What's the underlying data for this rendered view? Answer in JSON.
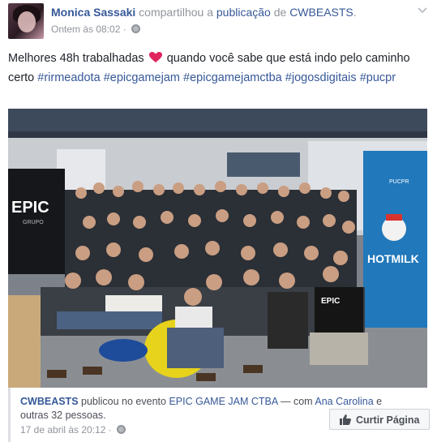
{
  "header": {
    "author": "Monica Sassaki",
    "verb": "compartilhou a",
    "object": "publicação",
    "preposition": "de",
    "source": "CWBEASTS",
    "period": ".",
    "timestamp": "Ontem às 08:02",
    "separator": "·",
    "privacy_icon": "globe-icon",
    "menu_icon": "chevron-down-icon"
  },
  "post": {
    "text_before_heart": "Melhores 48h trabalhadas",
    "heart_icon": "heart-emoji",
    "text_after_heart": "quando você sabe que está indo pelo caminho certo",
    "hashtags": [
      "#rirmeadota",
      "#epicgamejam",
      "#epicgamejamctba",
      "#jogosdigitais",
      "#pucpr"
    ]
  },
  "photo": {
    "banner_left": "EPIC",
    "banner_left_sub": "GRUPO",
    "banner_right": "HOTMILK",
    "banner_right_top": "PUCPR",
    "shirt_text": "EPIC"
  },
  "shared": {
    "page": "CWBEASTS",
    "verb": "publicou no evento",
    "event": "EPIC GAME JAM CTBA",
    "with": "— com",
    "tagged": "Ana Carolina",
    "conj": "e",
    "others": "outras 32 pessoas.",
    "date": "17 de abril às 20:12",
    "separator": "·",
    "like_button": "Curtir Página"
  },
  "colors": {
    "link": "#365899",
    "muted": "#90949c",
    "text": "#1d2129",
    "heart": "#e0245e"
  }
}
